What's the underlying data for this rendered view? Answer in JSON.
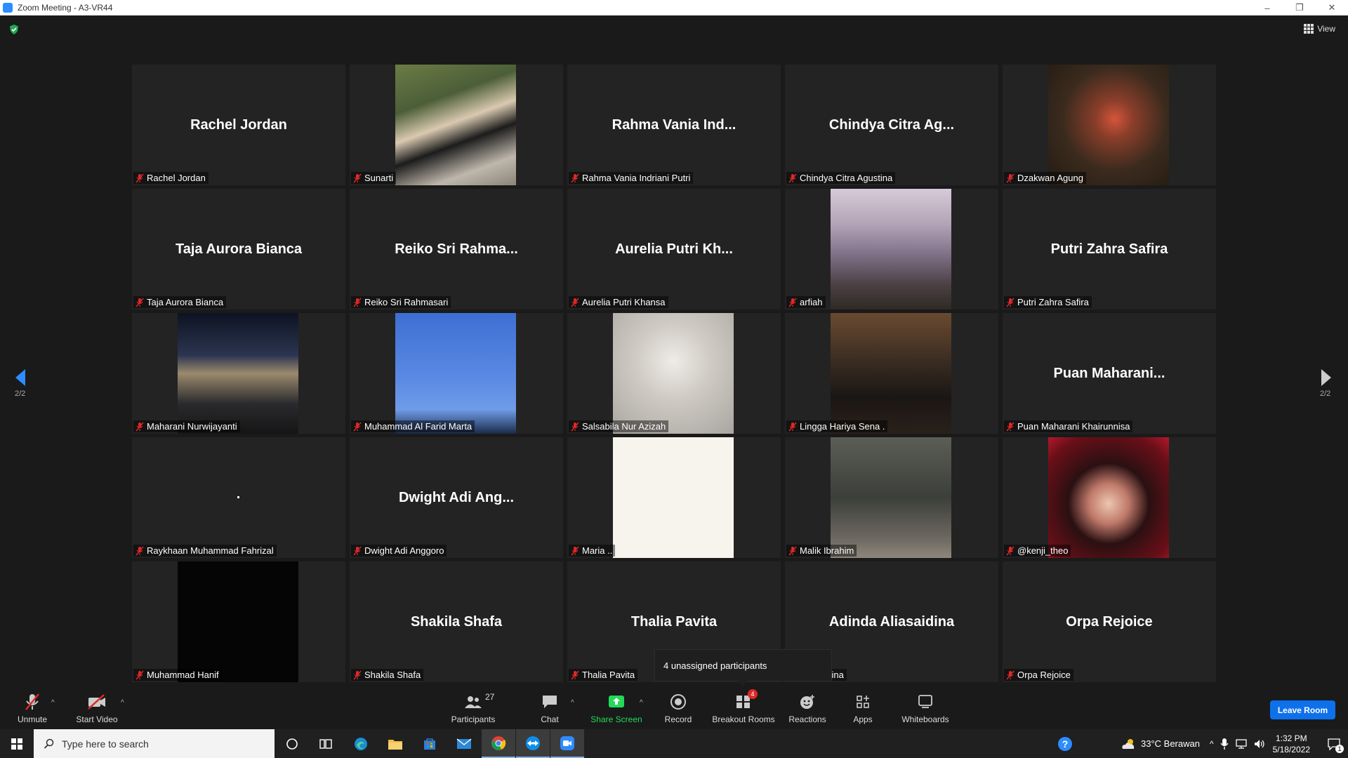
{
  "window": {
    "title": "Zoom Meeting - A3-VR44",
    "minimize": "–",
    "restore": "❐",
    "close": "✕"
  },
  "header": {
    "view_label": "View"
  },
  "page_nav": {
    "left": "2/2",
    "right": "2/2"
  },
  "tiles": [
    {
      "display": "Rachel Jordan",
      "label": "Rachel Jordan"
    },
    {
      "display": "",
      "label": "Sunarti"
    },
    {
      "display": "Rahma Vania Ind...",
      "label": "Rahma Vania Indriani Putri"
    },
    {
      "display": "Chindya Citra Ag...",
      "label": "Chindya Citra Agustina"
    },
    {
      "display": "",
      "label": "Dzakwan Agung"
    },
    {
      "display": "Taja Aurora Bianca",
      "label": "Taja Aurora Bianca"
    },
    {
      "display": "Reiko Sri Rahma...",
      "label": "Reiko Sri Rahmasari"
    },
    {
      "display": "Aurelia Putri Kh...",
      "label": "Aurelia Putri Khansa"
    },
    {
      "display": "",
      "label": "arfiah"
    },
    {
      "display": "Putri Zahra Safira",
      "label": "Putri Zahra Safira"
    },
    {
      "display": "",
      "label": "Maharani Nurwijayanti"
    },
    {
      "display": "",
      "label": "Muhammad Al Farid Marta"
    },
    {
      "display": "",
      "label": "Salsabila Nur Azizah"
    },
    {
      "display": "",
      "label": "Lingga Hariya Sena ."
    },
    {
      "display": "Puan Maharani...",
      "label": "Puan Maharani Khairunnisa"
    },
    {
      "display": "",
      "label": "Raykhaan Muhammad Fahrizal"
    },
    {
      "display": "Dwight Adi Ang...",
      "label": "Dwight Adi Anggoro"
    },
    {
      "display": "",
      "label": "Maria .."
    },
    {
      "display": "",
      "label": "Malik Ibrahim"
    },
    {
      "display": "",
      "label": "@kenji_theo"
    },
    {
      "display": "",
      "label": "Muhammad Hanif"
    },
    {
      "display": "Shakila Shafa",
      "label": "Shakila Shafa"
    },
    {
      "display": "Thalia Pavita",
      "label": "Thalia Pavita"
    },
    {
      "display": "Adinda Aliasaidina",
      "label": "Aliasaidina"
    },
    {
      "display": "Orpa Rejoice",
      "label": "Orpa Rejoice"
    }
  ],
  "popup": {
    "text": "4 unassigned participants"
  },
  "toolbar": {
    "unmute": "Unmute",
    "start_video": "Start Video",
    "participants": "Participants",
    "participants_count": "27",
    "chat": "Chat",
    "share_screen": "Share Screen",
    "record": "Record",
    "breakout_rooms": "Breakout Rooms",
    "breakout_badge": "4",
    "reactions": "Reactions",
    "apps": "Apps",
    "whiteboards": "Whiteboards",
    "leave": "Leave Room"
  },
  "taskbar": {
    "search_placeholder": "Type here to search",
    "weather": "33°C  Berawan",
    "time": "1:32 PM",
    "date": "5/18/2022",
    "notification_count": "1"
  },
  "colors": {
    "accent": "#0e71eb",
    "share_green": "#23d959",
    "muted_red": "#e02828"
  }
}
